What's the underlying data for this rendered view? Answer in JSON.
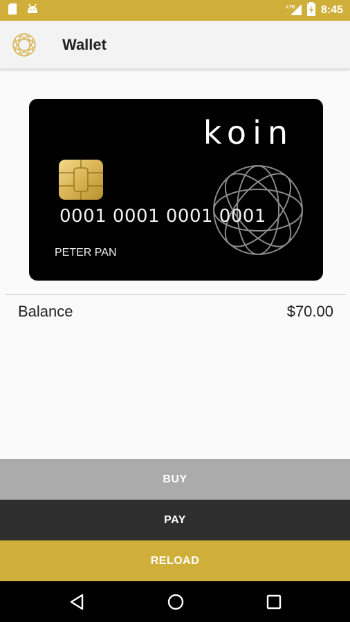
{
  "status_bar": {
    "time": "8:45",
    "network": "LTE",
    "icons": [
      "sd-card-icon",
      "android-icon",
      "signal-icon",
      "battery-icon"
    ]
  },
  "app_bar": {
    "title": "Wallet",
    "logo_icon": "globe-logo-icon"
  },
  "card": {
    "brand": "koin",
    "number": "0001 0001 0001 0001",
    "holder": "PETER PAN",
    "background": "#000000"
  },
  "balance": {
    "label": "Balance",
    "value": "$70.00"
  },
  "actions": {
    "buy_label": "BUY",
    "pay_label": "PAY",
    "reload_label": "RELOAD"
  },
  "nav": {
    "icons": [
      "back-icon",
      "home-icon",
      "recents-icon"
    ]
  },
  "colors": {
    "accent": "#cfaf3a",
    "buy": "#ababab",
    "pay": "#2e2e2e"
  }
}
